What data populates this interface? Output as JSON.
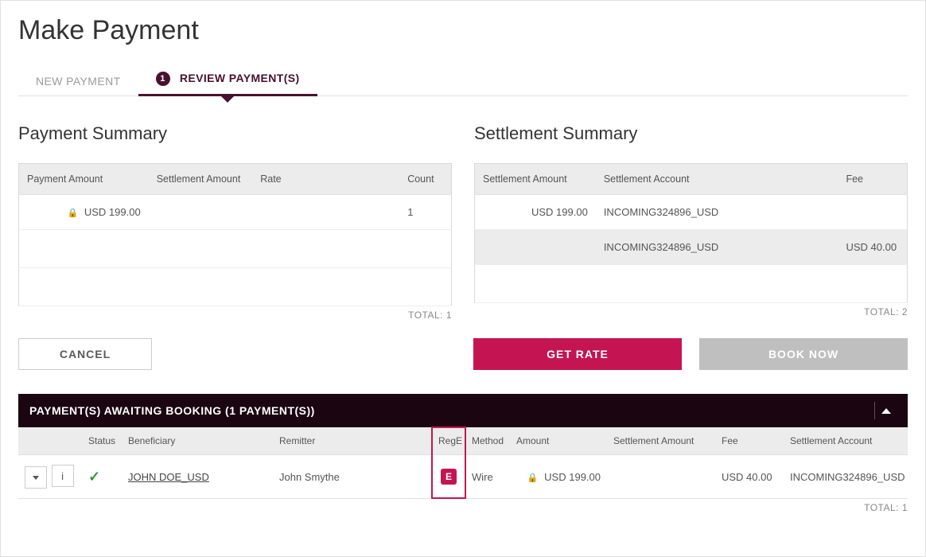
{
  "page_title": "Make Payment",
  "tabs": {
    "new_payment": "NEW PAYMENT",
    "review": "REVIEW PAYMENT(S)",
    "review_badge": "1"
  },
  "payment_summary": {
    "title": "Payment Summary",
    "headers": {
      "amount": "Payment Amount",
      "settlement": "Settlement Amount",
      "rate": "Rate",
      "count": "Count"
    },
    "row": {
      "amount": "USD 199.00",
      "settlement": "",
      "rate": "",
      "count": "1"
    },
    "total": "TOTAL: 1"
  },
  "settlement_summary": {
    "title": "Settlement Summary",
    "headers": {
      "amount": "Settlement Amount",
      "account": "Settlement Account",
      "fee": "Fee"
    },
    "rows": [
      {
        "amount": "USD 199.00",
        "account": "INCOMING324896_USD",
        "fee": ""
      },
      {
        "amount": "",
        "account": "INCOMING324896_USD",
        "fee": "USD 40.00"
      }
    ],
    "total": "TOTAL: 2"
  },
  "actions": {
    "cancel": "CANCEL",
    "get_rate": "GET RATE",
    "book_now": "BOOK NOW"
  },
  "awaiting": {
    "header": "PAYMENT(S) AWAITING BOOKING (1 PAYMENT(S))",
    "cols": {
      "status": "Status",
      "beneficiary": "Beneficiary",
      "remitter": "Remitter",
      "rege": "RegE",
      "method": "Method",
      "amount": "Amount",
      "settlement_amount": "Settlement Amount",
      "fee": "Fee",
      "settlement_account": "Settlement Account"
    },
    "row": {
      "beneficiary": "JOHN DOE_USD",
      "remitter": "John Smythe",
      "rege": "E",
      "method": "Wire",
      "amount": "USD 199.00",
      "settlement_amount": "",
      "fee": "USD 40.00",
      "settlement_account": "INCOMING324896_USD"
    },
    "total": "TOTAL: 1"
  },
  "info_char": "i",
  "check_char": "✓",
  "lock_char": "🔒"
}
